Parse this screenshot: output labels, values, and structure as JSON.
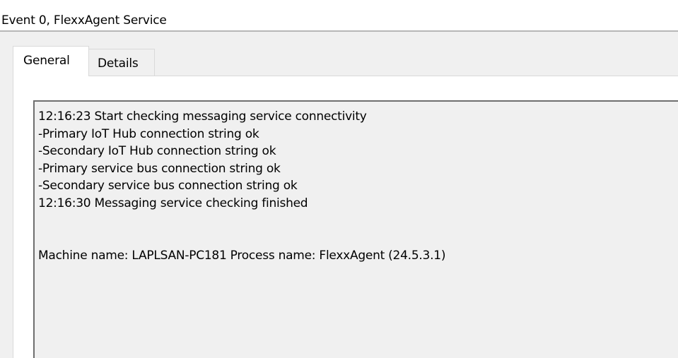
{
  "window": {
    "title": "Event 0, FlexxAgent Service"
  },
  "tabs": [
    {
      "label": "General",
      "selected": true
    },
    {
      "label": "Details",
      "selected": false
    }
  ],
  "message": {
    "lines": [
      "12:16:23 Start checking messaging service connectivity",
      "-Primary IoT Hub connection string ok",
      "-Secondary IoT Hub connection string ok",
      "-Primary service bus connection string ok",
      "-Secondary service bus connection string ok",
      "12:16:30 Messaging service checking finished"
    ],
    "footer": "Machine name: LAPLSAN-PC181 Process name: FlexxAgent (24.5.3.1)"
  }
}
